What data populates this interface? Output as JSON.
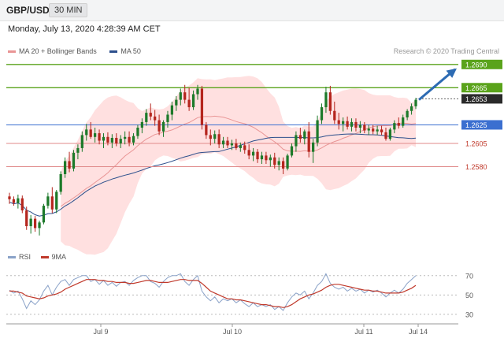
{
  "header": {
    "pair": "GBP/USD",
    "timeframe": "30 MIN"
  },
  "datetime": "Monday, July 13, 2020 4:28:39 AM CET",
  "legend": {
    "ma20_bb": "MA 20 + Bollinger Bands",
    "ma50": "MA 50",
    "rsi": "RSI",
    "ma9": "9MA"
  },
  "research": "Research © 2020 Trading Central",
  "colors": {
    "resistance": "#5aa31b",
    "support": "#e08a8a",
    "pivot": "#3b6fd0",
    "bull": "#1d7a2a",
    "bear": "#b5261e",
    "bb_fill": "#ffd6d6",
    "ma20": "#e99595",
    "ma50": "#2c4f8c",
    "rsi": "#8aa2c8",
    "ma9": "#c0392b",
    "arrow": "#2d6bb3"
  },
  "chart_data": [
    {
      "type": "candlestick",
      "x_labels": [
        "Jul 9",
        "Jul 10",
        "Jul 11",
        "Jul 14"
      ],
      "ylim": [
        1.2505,
        1.27
      ],
      "levels": [
        {
          "value": 1.269,
          "label": "1.2690",
          "kind": "resistance"
        },
        {
          "value": 1.2665,
          "label": "1.2665",
          "kind": "resistance"
        },
        {
          "value": 1.2653,
          "label": "1.2653",
          "kind": "current"
        },
        {
          "value": 1.2625,
          "label": "1.2625",
          "kind": "pivot"
        },
        {
          "value": 1.2605,
          "label": "1.2605",
          "kind": "support"
        },
        {
          "value": 1.258,
          "label": "1.2580",
          "kind": "support"
        }
      ],
      "candles": [
        [
          1.2548,
          1.2552,
          1.254,
          1.2545
        ],
        [
          1.2545,
          1.2548,
          1.2538,
          1.2541
        ],
        [
          1.2541,
          1.255,
          1.2535,
          1.2546
        ],
        [
          1.2546,
          1.2549,
          1.253,
          1.2533
        ],
        [
          1.2533,
          1.2537,
          1.2512,
          1.2516
        ],
        [
          1.2516,
          1.2528,
          1.2508,
          1.2524
        ],
        [
          1.2524,
          1.2527,
          1.251,
          1.2514
        ],
        [
          1.2514,
          1.2522,
          1.2506,
          1.252
        ],
        [
          1.252,
          1.254,
          1.2518,
          1.2538
        ],
        [
          1.2538,
          1.2552,
          1.2535,
          1.2548
        ],
        [
          1.2548,
          1.2558,
          1.253,
          1.2534
        ],
        [
          1.2534,
          1.2555,
          1.253,
          1.2553
        ],
        [
          1.2553,
          1.2575,
          1.255,
          1.2572
        ],
        [
          1.2572,
          1.259,
          1.2568,
          1.2586
        ],
        [
          1.2586,
          1.2596,
          1.2574,
          1.2578
        ],
        [
          1.2578,
          1.2598,
          1.2575,
          1.2595
        ],
        [
          1.2595,
          1.2604,
          1.2588,
          1.26
        ],
        [
          1.26,
          1.2618,
          1.2596,
          1.2614
        ],
        [
          1.2614,
          1.2626,
          1.2608,
          1.262
        ],
        [
          1.262,
          1.2628,
          1.261,
          1.2612
        ],
        [
          1.2612,
          1.2622,
          1.2606,
          1.2616
        ],
        [
          1.2616,
          1.262,
          1.2604,
          1.2608
        ],
        [
          1.2608,
          1.2616,
          1.26,
          1.2612
        ],
        [
          1.2612,
          1.2617,
          1.2603,
          1.2606
        ],
        [
          1.2606,
          1.2615,
          1.26,
          1.2611
        ],
        [
          1.2611,
          1.2616,
          1.2602,
          1.2605
        ],
        [
          1.2605,
          1.2614,
          1.26,
          1.261
        ],
        [
          1.261,
          1.2618,
          1.2604,
          1.2612
        ],
        [
          1.2612,
          1.2618,
          1.2602,
          1.2606
        ],
        [
          1.2606,
          1.2616,
          1.2603,
          1.2613
        ],
        [
          1.2613,
          1.2625,
          1.261,
          1.2622
        ],
        [
          1.2622,
          1.2632,
          1.2616,
          1.2628
        ],
        [
          1.2628,
          1.2642,
          1.2624,
          1.2638
        ],
        [
          1.2638,
          1.2648,
          1.263,
          1.2634
        ],
        [
          1.2634,
          1.2641,
          1.2624,
          1.263
        ],
        [
          1.263,
          1.2636,
          1.2614,
          1.2618
        ],
        [
          1.2618,
          1.263,
          1.2612,
          1.2628
        ],
        [
          1.2628,
          1.264,
          1.2622,
          1.2636
        ],
        [
          1.2636,
          1.265,
          1.263,
          1.2646
        ],
        [
          1.2646,
          1.2656,
          1.264,
          1.2652
        ],
        [
          1.2652,
          1.2664,
          1.2646,
          1.266
        ],
        [
          1.266,
          1.2668,
          1.2648,
          1.2652
        ],
        [
          1.2652,
          1.2665,
          1.264,
          1.2644
        ],
        [
          1.2644,
          1.2662,
          1.2641,
          1.2658
        ],
        [
          1.2658,
          1.2668,
          1.2652,
          1.2664
        ],
        [
          1.2664,
          1.2667,
          1.262,
          1.2625
        ],
        [
          1.2625,
          1.2628,
          1.261,
          1.2614
        ],
        [
          1.2614,
          1.262,
          1.2603,
          1.261
        ],
        [
          1.261,
          1.2619,
          1.2605,
          1.2615
        ],
        [
          1.2615,
          1.262,
          1.26,
          1.2604
        ],
        [
          1.2604,
          1.2612,
          1.26,
          1.2608
        ],
        [
          1.2608,
          1.2612,
          1.26,
          1.2603
        ],
        [
          1.2603,
          1.2609,
          1.2598,
          1.2605
        ],
        [
          1.2605,
          1.261,
          1.2598,
          1.26
        ],
        [
          1.26,
          1.2606,
          1.2596,
          1.2603
        ],
        [
          1.2603,
          1.2607,
          1.2594,
          1.2598
        ],
        [
          1.2598,
          1.2604,
          1.2588,
          1.2592
        ],
        [
          1.2592,
          1.26,
          1.2586,
          1.2596
        ],
        [
          1.2596,
          1.2599,
          1.2584,
          1.2588
        ],
        [
          1.2588,
          1.2596,
          1.2583,
          1.2592
        ],
        [
          1.2592,
          1.2596,
          1.2583,
          1.2587
        ],
        [
          1.2587,
          1.2593,
          1.258,
          1.259
        ],
        [
          1.259,
          1.2595,
          1.2578,
          1.2582
        ],
        [
          1.2582,
          1.259,
          1.2576,
          1.2586
        ],
        [
          1.2586,
          1.259,
          1.2572,
          1.2578
        ],
        [
          1.2578,
          1.2594,
          1.2576,
          1.2592
        ],
        [
          1.2592,
          1.2605,
          1.259,
          1.2602
        ],
        [
          1.2602,
          1.2618,
          1.2596,
          1.2614
        ],
        [
          1.2614,
          1.2622,
          1.2606,
          1.261
        ],
        [
          1.261,
          1.262,
          1.2604,
          1.2618
        ],
        [
          1.2618,
          1.2628,
          1.259,
          1.2596
        ],
        [
          1.2596,
          1.261,
          1.2584,
          1.2606
        ],
        [
          1.2606,
          1.2635,
          1.2602,
          1.263
        ],
        [
          1.263,
          1.2648,
          1.2626,
          1.2644
        ],
        [
          1.2644,
          1.2666,
          1.2638,
          1.266
        ],
        [
          1.266,
          1.2667,
          1.2636,
          1.264
        ],
        [
          1.264,
          1.265,
          1.2626,
          1.263
        ],
        [
          1.263,
          1.2638,
          1.262,
          1.2626
        ],
        [
          1.2626,
          1.2633,
          1.2618,
          1.2629
        ],
        [
          1.2629,
          1.2634,
          1.262,
          1.2623
        ],
        [
          1.2623,
          1.2632,
          1.2618,
          1.2628
        ],
        [
          1.2628,
          1.2632,
          1.2618,
          1.2622
        ],
        [
          1.2622,
          1.2629,
          1.2616,
          1.2625
        ],
        [
          1.2625,
          1.2628,
          1.2616,
          1.2619
        ],
        [
          1.2619,
          1.2625,
          1.2614,
          1.2621
        ],
        [
          1.2621,
          1.2625,
          1.2615,
          1.2618
        ],
        [
          1.2618,
          1.2624,
          1.2614,
          1.262
        ],
        [
          1.262,
          1.2624,
          1.2614,
          1.2617
        ],
        [
          1.2617,
          1.2622,
          1.2608,
          1.261
        ],
        [
          1.261,
          1.2622,
          1.2608,
          1.262
        ],
        [
          1.262,
          1.263,
          1.2616,
          1.2627
        ],
        [
          1.2627,
          1.2633,
          1.2621,
          1.2624
        ],
        [
          1.2624,
          1.2636,
          1.2622,
          1.2633
        ],
        [
          1.2633,
          1.2642,
          1.263,
          1.264
        ],
        [
          1.264,
          1.2648,
          1.2636,
          1.2645
        ],
        [
          1.2645,
          1.2654,
          1.2642,
          1.2652
        ]
      ]
    },
    {
      "type": "line",
      "ylim": [
        25,
        78
      ],
      "y_ticks": [
        30,
        50,
        70
      ],
      "x_labels": [
        "Jul 9",
        "Jul 10",
        "Jul 11",
        "Jul 14"
      ],
      "series": [
        {
          "name": "RSI",
          "values": [
            55,
            52,
            54,
            46,
            36,
            44,
            40,
            45,
            54,
            60,
            50,
            58,
            64,
            66,
            60,
            66,
            68,
            70,
            70,
            64,
            66,
            61,
            65,
            60,
            63,
            59,
            63,
            64,
            60,
            65,
            68,
            70,
            70,
            64,
            62,
            58,
            64,
            68,
            70,
            70,
            72,
            64,
            60,
            66,
            70,
            54,
            48,
            44,
            48,
            42,
            46,
            44,
            46,
            42,
            45,
            41,
            38,
            42,
            38,
            40,
            38,
            40,
            35,
            38,
            34,
            42,
            48,
            52,
            50,
            54,
            46,
            52,
            60,
            64,
            72,
            62,
            58,
            56,
            58,
            54,
            57,
            54,
            56,
            52,
            55,
            53,
            55,
            52,
            48,
            52,
            55,
            52,
            56,
            62,
            66,
            70
          ]
        },
        {
          "name": "9MA",
          "values": [
            54,
            54,
            53,
            52,
            49,
            48,
            47,
            46,
            47,
            49,
            50,
            51,
            53,
            56,
            58,
            60,
            62,
            64,
            66,
            66,
            66,
            65,
            65,
            64,
            64,
            63,
            63,
            63,
            62,
            62,
            63,
            64,
            65,
            65,
            64,
            63,
            63,
            63,
            64,
            65,
            66,
            66,
            65,
            65,
            65,
            62,
            58,
            54,
            52,
            50,
            48,
            46,
            46,
            45,
            45,
            44,
            43,
            42,
            41,
            40,
            40,
            39,
            38,
            38,
            37,
            38,
            40,
            43,
            46,
            48,
            50,
            51,
            53,
            55,
            58,
            60,
            61,
            61,
            60,
            59,
            58,
            57,
            56,
            55,
            55,
            54,
            54,
            53,
            52,
            52,
            52,
            52,
            53,
            55,
            57,
            60
          ]
        }
      ]
    }
  ]
}
